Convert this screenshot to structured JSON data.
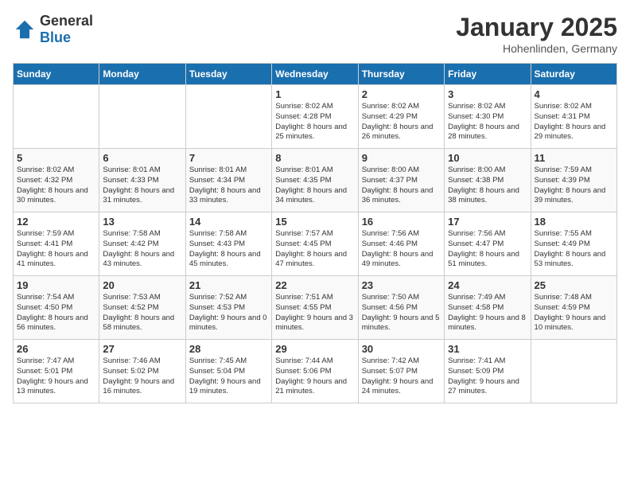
{
  "header": {
    "logo_general": "General",
    "logo_blue": "Blue",
    "month_title": "January 2025",
    "location": "Hohenlinden, Germany"
  },
  "days_of_week": [
    "Sunday",
    "Monday",
    "Tuesday",
    "Wednesday",
    "Thursday",
    "Friday",
    "Saturday"
  ],
  "weeks": [
    [
      {
        "day": "",
        "data": ""
      },
      {
        "day": "",
        "data": ""
      },
      {
        "day": "",
        "data": ""
      },
      {
        "day": "1",
        "data": "Sunrise: 8:02 AM\nSunset: 4:28 PM\nDaylight: 8 hours and 25 minutes."
      },
      {
        "day": "2",
        "data": "Sunrise: 8:02 AM\nSunset: 4:29 PM\nDaylight: 8 hours and 26 minutes."
      },
      {
        "day": "3",
        "data": "Sunrise: 8:02 AM\nSunset: 4:30 PM\nDaylight: 8 hours and 28 minutes."
      },
      {
        "day": "4",
        "data": "Sunrise: 8:02 AM\nSunset: 4:31 PM\nDaylight: 8 hours and 29 minutes."
      }
    ],
    [
      {
        "day": "5",
        "data": "Sunrise: 8:02 AM\nSunset: 4:32 PM\nDaylight: 8 hours and 30 minutes."
      },
      {
        "day": "6",
        "data": "Sunrise: 8:01 AM\nSunset: 4:33 PM\nDaylight: 8 hours and 31 minutes."
      },
      {
        "day": "7",
        "data": "Sunrise: 8:01 AM\nSunset: 4:34 PM\nDaylight: 8 hours and 33 minutes."
      },
      {
        "day": "8",
        "data": "Sunrise: 8:01 AM\nSunset: 4:35 PM\nDaylight: 8 hours and 34 minutes."
      },
      {
        "day": "9",
        "data": "Sunrise: 8:00 AM\nSunset: 4:37 PM\nDaylight: 8 hours and 36 minutes."
      },
      {
        "day": "10",
        "data": "Sunrise: 8:00 AM\nSunset: 4:38 PM\nDaylight: 8 hours and 38 minutes."
      },
      {
        "day": "11",
        "data": "Sunrise: 7:59 AM\nSunset: 4:39 PM\nDaylight: 8 hours and 39 minutes."
      }
    ],
    [
      {
        "day": "12",
        "data": "Sunrise: 7:59 AM\nSunset: 4:41 PM\nDaylight: 8 hours and 41 minutes."
      },
      {
        "day": "13",
        "data": "Sunrise: 7:58 AM\nSunset: 4:42 PM\nDaylight: 8 hours and 43 minutes."
      },
      {
        "day": "14",
        "data": "Sunrise: 7:58 AM\nSunset: 4:43 PM\nDaylight: 8 hours and 45 minutes."
      },
      {
        "day": "15",
        "data": "Sunrise: 7:57 AM\nSunset: 4:45 PM\nDaylight: 8 hours and 47 minutes."
      },
      {
        "day": "16",
        "data": "Sunrise: 7:56 AM\nSunset: 4:46 PM\nDaylight: 8 hours and 49 minutes."
      },
      {
        "day": "17",
        "data": "Sunrise: 7:56 AM\nSunset: 4:47 PM\nDaylight: 8 hours and 51 minutes."
      },
      {
        "day": "18",
        "data": "Sunrise: 7:55 AM\nSunset: 4:49 PM\nDaylight: 8 hours and 53 minutes."
      }
    ],
    [
      {
        "day": "19",
        "data": "Sunrise: 7:54 AM\nSunset: 4:50 PM\nDaylight: 8 hours and 56 minutes."
      },
      {
        "day": "20",
        "data": "Sunrise: 7:53 AM\nSunset: 4:52 PM\nDaylight: 8 hours and 58 minutes."
      },
      {
        "day": "21",
        "data": "Sunrise: 7:52 AM\nSunset: 4:53 PM\nDaylight: 9 hours and 0 minutes."
      },
      {
        "day": "22",
        "data": "Sunrise: 7:51 AM\nSunset: 4:55 PM\nDaylight: 9 hours and 3 minutes."
      },
      {
        "day": "23",
        "data": "Sunrise: 7:50 AM\nSunset: 4:56 PM\nDaylight: 9 hours and 5 minutes."
      },
      {
        "day": "24",
        "data": "Sunrise: 7:49 AM\nSunset: 4:58 PM\nDaylight: 9 hours and 8 minutes."
      },
      {
        "day": "25",
        "data": "Sunrise: 7:48 AM\nSunset: 4:59 PM\nDaylight: 9 hours and 10 minutes."
      }
    ],
    [
      {
        "day": "26",
        "data": "Sunrise: 7:47 AM\nSunset: 5:01 PM\nDaylight: 9 hours and 13 minutes."
      },
      {
        "day": "27",
        "data": "Sunrise: 7:46 AM\nSunset: 5:02 PM\nDaylight: 9 hours and 16 minutes."
      },
      {
        "day": "28",
        "data": "Sunrise: 7:45 AM\nSunset: 5:04 PM\nDaylight: 9 hours and 19 minutes."
      },
      {
        "day": "29",
        "data": "Sunrise: 7:44 AM\nSunset: 5:06 PM\nDaylight: 9 hours and 21 minutes."
      },
      {
        "day": "30",
        "data": "Sunrise: 7:42 AM\nSunset: 5:07 PM\nDaylight: 9 hours and 24 minutes."
      },
      {
        "day": "31",
        "data": "Sunrise: 7:41 AM\nSunset: 5:09 PM\nDaylight: 9 hours and 27 minutes."
      },
      {
        "day": "",
        "data": ""
      }
    ]
  ]
}
